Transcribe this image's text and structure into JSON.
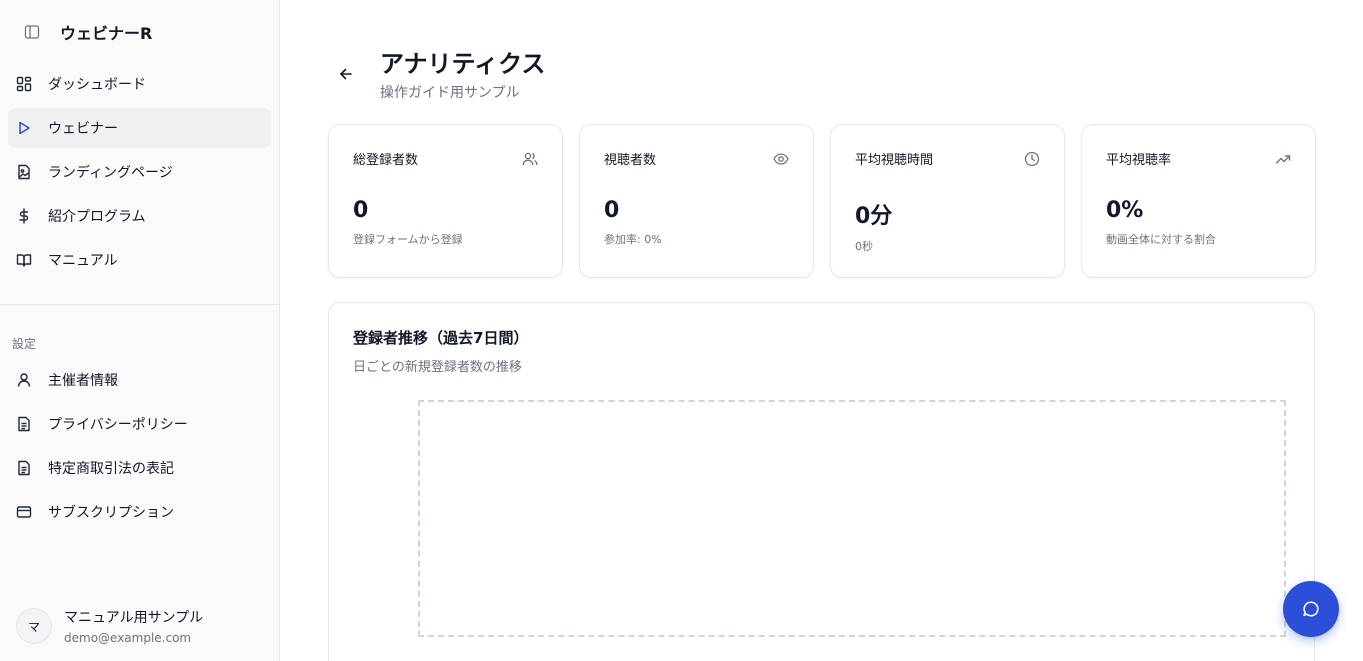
{
  "sidebar": {
    "brand": "ウェビナーR",
    "nav_items": [
      {
        "label": "ダッシュボード"
      },
      {
        "label": "ウェビナー"
      },
      {
        "label": "ランディングページ"
      },
      {
        "label": "紹介プログラム"
      },
      {
        "label": "マニュアル"
      }
    ],
    "section_label": "設定",
    "settings_items": [
      {
        "label": "主催者情報"
      },
      {
        "label": "プライバシーポリシー"
      },
      {
        "label": "特定商取引法の表記"
      },
      {
        "label": "サブスクリプション"
      }
    ],
    "user": {
      "initial": "マ",
      "name": "マニュアル用サンプル",
      "email": "demo@example.com"
    }
  },
  "header": {
    "title": "アナリティクス",
    "subtitle": "操作ガイド用サンプル"
  },
  "stats": [
    {
      "label": "総登録者数",
      "value": "0",
      "note": "登録フォームから登録",
      "icon": "users-icon"
    },
    {
      "label": "視聴者数",
      "value": "0",
      "note": "参加率: 0%",
      "icon": "eye-icon"
    },
    {
      "label": "平均視聴時間",
      "value": "0分",
      "note": "0秒",
      "icon": "clock-icon"
    },
    {
      "label": "平均視聴率",
      "value": "0%",
      "note": "動画全体に対する割合",
      "icon": "trending-up-icon"
    }
  ],
  "chart": {
    "title": "登録者推移（過去7日間）",
    "description": "日ごとの新規登録者数の推移"
  },
  "colors": {
    "accent": "#2b4fd8",
    "border": "#e5e7eb",
    "muted_text": "#6b7280"
  }
}
